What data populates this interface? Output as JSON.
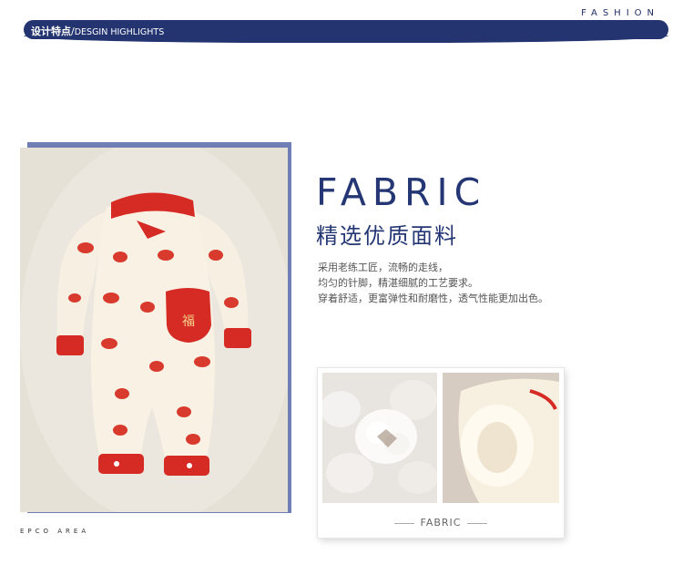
{
  "top_label": "FASHION",
  "header": {
    "title_cn": "设计特点",
    "separator": "/",
    "title_en": "DESGIN HIGHLIGHTS"
  },
  "product_image": {
    "caption": "EPCO AREA"
  },
  "section": {
    "title": "FABRIC",
    "subtitle": "精选优质面料",
    "description": [
      "采用老练工匠，流畅的走线，",
      "均匀的针脚，精湛细腻的工艺要求。",
      "穿着舒适，更富弹性和耐磨性，透气性能更加出色。"
    ]
  },
  "fabric_card": {
    "caption": "FABRIC"
  },
  "colors": {
    "navy": "#233471",
    "accent": "#6f7fb5",
    "red": "#d62b24"
  }
}
